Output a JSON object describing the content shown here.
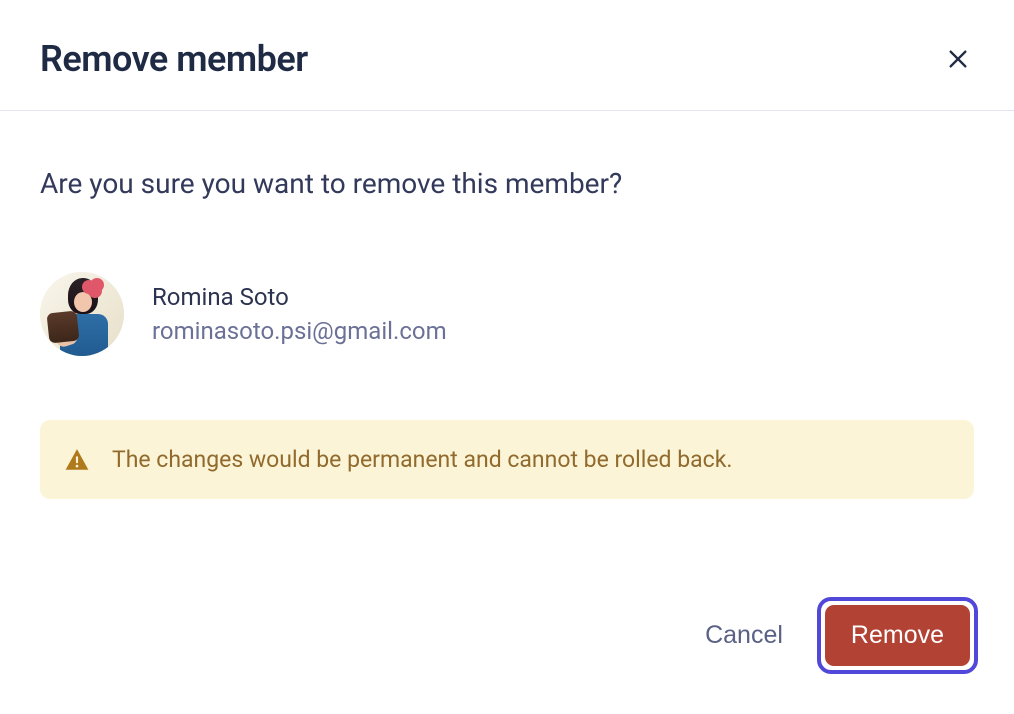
{
  "dialog": {
    "title": "Remove member",
    "confirm_text": "Are you sure you want to remove this member?",
    "member": {
      "name": "Romina Soto",
      "email": "rominasoto.psi@gmail.com"
    },
    "alert": {
      "text": "The changes would be permanent and cannot be rolled back."
    },
    "actions": {
      "cancel_label": "Cancel",
      "remove_label": "Remove"
    }
  },
  "icons": {
    "close": "close-icon",
    "warning": "warning-icon"
  },
  "colors": {
    "title": "#1f2a44",
    "body_text": "#32395a",
    "muted": "#6b7196",
    "alert_bg": "#fcf4d6",
    "alert_text": "#916a2d",
    "alert_icon": "#b07a1c",
    "danger": "#b24334",
    "focus_ring": "#5148d9",
    "divider": "#e3e6f2"
  }
}
